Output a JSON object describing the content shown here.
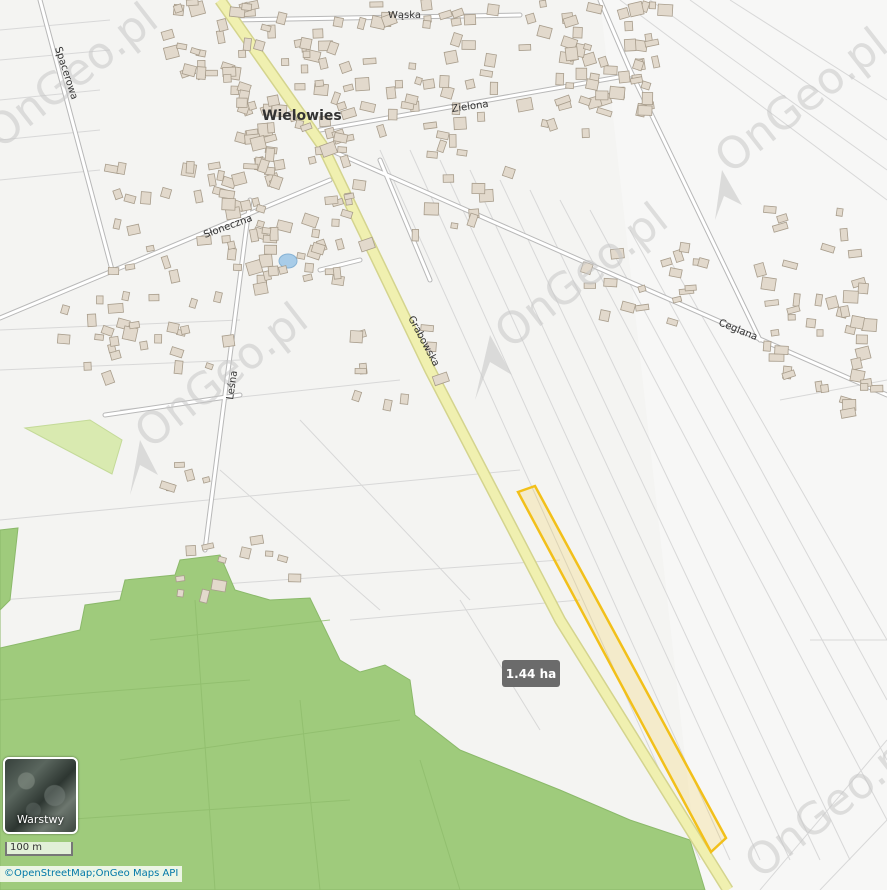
{
  "map": {
    "town_name": "Wielowies",
    "streets": {
      "waska": "Wąska",
      "zielona": "Zielona",
      "sloneczna": "Słoneczna",
      "spacerowa": "Spacerowa",
      "grabowska": "Grabowska",
      "ceglana": "Ceglana",
      "lesna": "Leśna"
    },
    "watermark": "OnGeo.pl",
    "parcel_area": "1.44 ha",
    "colors": {
      "forest": "#9fcb7c",
      "main_road": "#f0f0b0",
      "parcel_outline": "#f2c01a",
      "building": "#e2d9cc"
    }
  },
  "controls": {
    "layers_label": "Warstwy",
    "scale_label": "100 m"
  },
  "attribution": "©OpenStreetMap;OnGeo Maps API"
}
